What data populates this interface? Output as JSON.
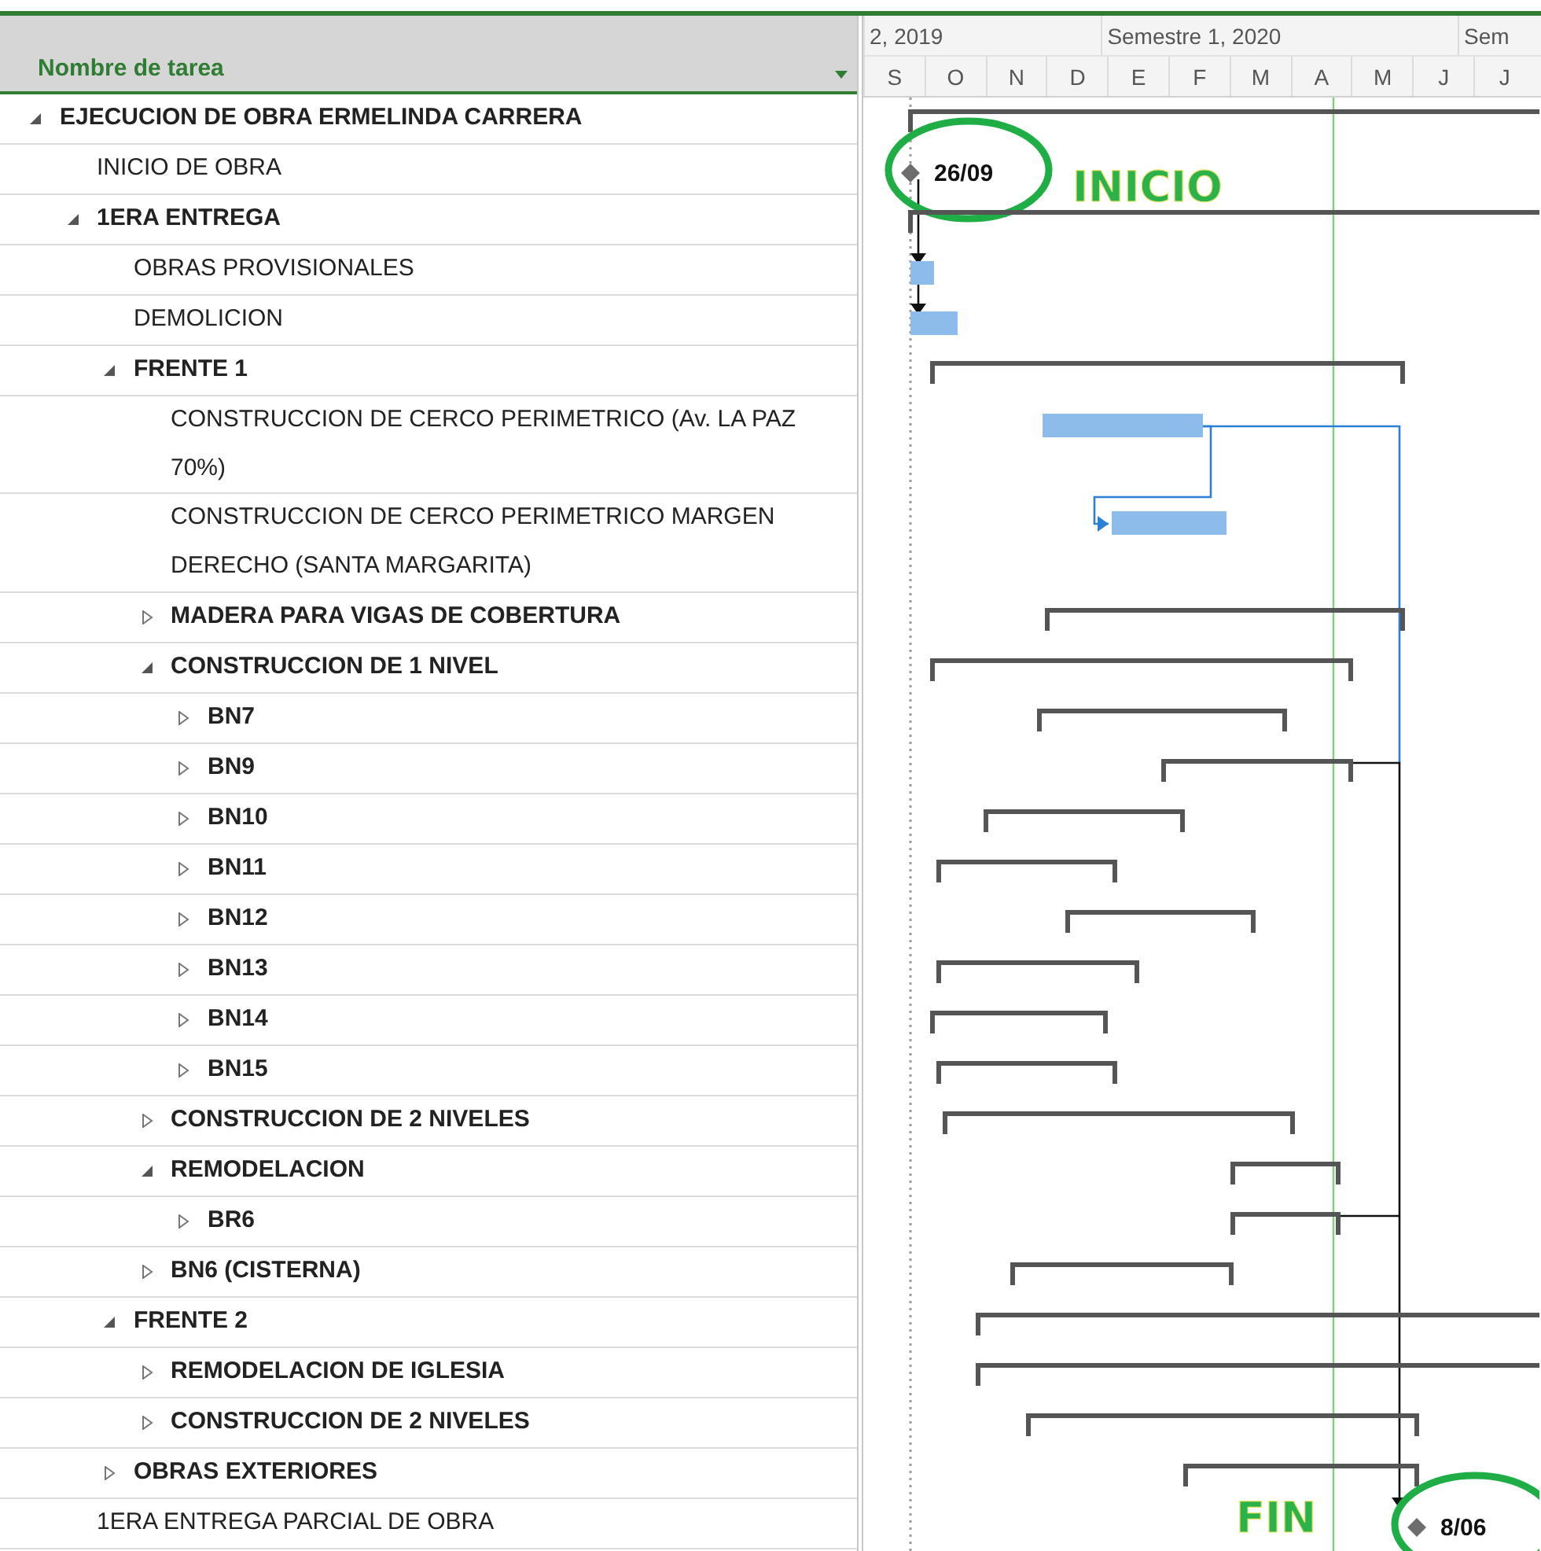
{
  "task_table": {
    "column_header": "Nombre de tarea"
  },
  "timescale": {
    "top_tier": [
      "2, 2019",
      "Semestre 1, 2020",
      "Sem"
    ],
    "bottom_tier": [
      "S",
      "O",
      "N",
      "D",
      "E",
      "F",
      "M",
      "A",
      "M",
      "J",
      "J"
    ]
  },
  "tasks": [
    {
      "name": "EJECUCION DE OBRA ERMELINDA CARRERA",
      "kind": "summary",
      "expanded": true,
      "children": [
        {
          "name": "INICIO DE OBRA",
          "kind": "milestone",
          "date_label": "26/09",
          "annotation": "INICIO"
        },
        {
          "name": "1ERA ENTREGA",
          "kind": "summary",
          "expanded": true,
          "children": [
            {
              "name": "OBRAS PROVISIONALES",
              "kind": "task"
            },
            {
              "name": "DEMOLICION",
              "kind": "task"
            },
            {
              "name": "FRENTE 1",
              "kind": "summary",
              "expanded": true,
              "children": [
                {
                  "name": "CONSTRUCCION DE CERCO PERIMETRICO (Av. LA PAZ 70%)",
                  "kind": "task"
                },
                {
                  "name": "CONSTRUCCION DE CERCO PERIMETRICO MARGEN DERECHO (SANTA MARGARITA)",
                  "kind": "task"
                },
                {
                  "name": "MADERA PARA VIGAS DE COBERTURA",
                  "kind": "summary",
                  "expanded": false
                },
                {
                  "name": "CONSTRUCCION DE 1 NIVEL",
                  "kind": "summary",
                  "expanded": true,
                  "children": [
                    {
                      "name": "BN7",
                      "kind": "summary",
                      "expanded": false
                    },
                    {
                      "name": "BN9",
                      "kind": "summary",
                      "expanded": false
                    },
                    {
                      "name": "BN10",
                      "kind": "summary",
                      "expanded": false
                    },
                    {
                      "name": "BN11",
                      "kind": "summary",
                      "expanded": false
                    },
                    {
                      "name": "BN12",
                      "kind": "summary",
                      "expanded": false
                    },
                    {
                      "name": "BN13",
                      "kind": "summary",
                      "expanded": false
                    },
                    {
                      "name": "BN14",
                      "kind": "summary",
                      "expanded": false
                    },
                    {
                      "name": "BN15",
                      "kind": "summary",
                      "expanded": false
                    }
                  ]
                },
                {
                  "name": "CONSTRUCCION DE 2 NIVELES",
                  "kind": "summary",
                  "expanded": false
                },
                {
                  "name": "REMODELACION",
                  "kind": "summary",
                  "expanded": true,
                  "children": [
                    {
                      "name": "BR6",
                      "kind": "summary",
                      "expanded": false
                    }
                  ]
                },
                {
                  "name": "BN6 (CISTERNA)",
                  "kind": "summary",
                  "expanded": false
                }
              ]
            },
            {
              "name": "FRENTE 2",
              "kind": "summary",
              "expanded": true,
              "children": [
                {
                  "name": "REMODELACION DE IGLESIA",
                  "kind": "summary",
                  "expanded": false
                },
                {
                  "name": "CONSTRUCCION DE 2 NIVELES",
                  "kind": "summary",
                  "expanded": false
                }
              ]
            },
            {
              "name": "OBRAS EXTERIORES",
              "kind": "summary",
              "expanded": false
            }
          ]
        },
        {
          "name": "1ERA ENTREGA PARCIAL DE OBRA",
          "kind": "milestone",
          "date_label": "8/06",
          "annotation": "FIN"
        }
      ]
    }
  ]
}
